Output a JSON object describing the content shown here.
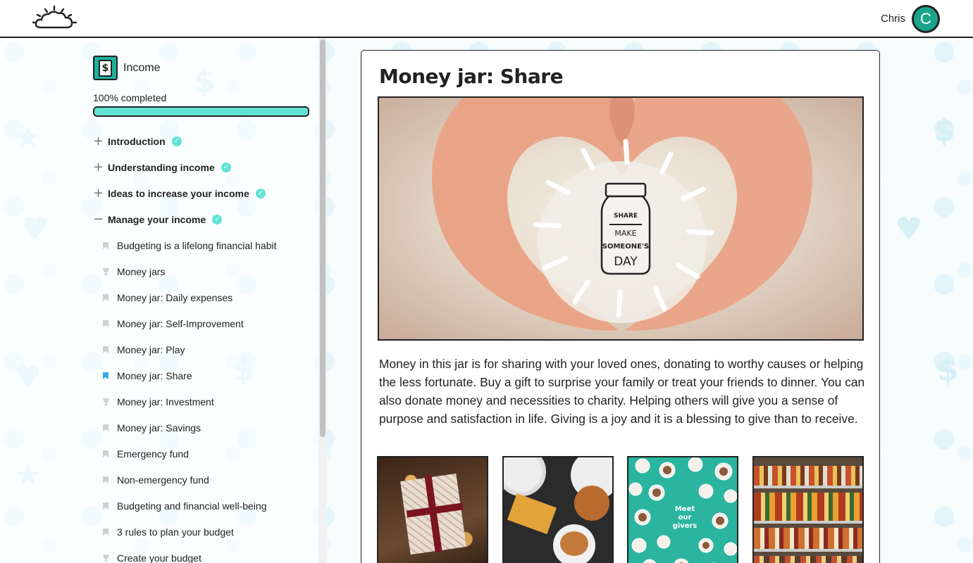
{
  "header": {
    "logo_icon": "cloud-sun-logo-icon",
    "user_name": "Chris",
    "avatar_initial": "C",
    "avatar_color": "#1aa58a"
  },
  "sidebar": {
    "course_icon": "money-dollar-icon",
    "course_title": "Income",
    "progress_text": "100% completed",
    "progress": 1.0,
    "progress_color": "#62e3d6",
    "sections": [
      {
        "label": "Introduction",
        "toggle": "+",
        "completed": true
      },
      {
        "label": "Understanding income",
        "toggle": "+",
        "completed": true
      },
      {
        "label": "Ideas to increase your income",
        "toggle": "+",
        "completed": true
      },
      {
        "label": "Manage your income",
        "toggle": "−",
        "completed": true
      }
    ],
    "items": [
      {
        "label": "Budgeting is a lifelong financial habit",
        "icon": "bookmark-icon"
      },
      {
        "label": "Money jars",
        "icon": "trophy-icon"
      },
      {
        "label": "Money jar: Daily expenses",
        "icon": "bookmark-icon"
      },
      {
        "label": "Money jar: Self-Improvement",
        "icon": "bookmark-icon"
      },
      {
        "label": "Money jar: Play",
        "icon": "bookmark-icon"
      },
      {
        "label": "Money jar: Share",
        "icon": "bookmark-icon",
        "active": true
      },
      {
        "label": "Money jar: Investment",
        "icon": "trophy-icon"
      },
      {
        "label": "Money jar: Savings",
        "icon": "bookmark-icon"
      },
      {
        "label": "Emergency fund",
        "icon": "bookmark-icon"
      },
      {
        "label": "Non-emergency fund",
        "icon": "bookmark-icon"
      },
      {
        "label": "Budgeting and financial well-being",
        "icon": "bookmark-icon"
      },
      {
        "label": "3 rules to plan your budget",
        "icon": "bookmark-icon"
      },
      {
        "label": "Create your budget",
        "icon": "trophy-icon"
      }
    ]
  },
  "main": {
    "title": "Money jar: Share",
    "hero_jar_top": "SHARE",
    "hero_jar_line1": "MAKE",
    "hero_jar_line2": "SOMEONE'S",
    "hero_jar_line3": "DAY",
    "body": "Money in this jar is for sharing with your loved ones, donating to worthy causes or helping the less fortunate. Buy a gift to surprise your family or treat your friends to dinner. You can also donate money and necessities to charity. Helping others will give you a sense of purpose and satisfaction in life. Giving is a joy and it is a blessing to give than to receive.",
    "thumbnails": [
      {
        "name": "gift-photo"
      },
      {
        "name": "dinner-photo"
      },
      {
        "name": "meet-our-givers-photo",
        "text_line1": "Meet",
        "text_line2": "our",
        "text_line3": "givers"
      },
      {
        "name": "pantry-photo"
      }
    ]
  }
}
